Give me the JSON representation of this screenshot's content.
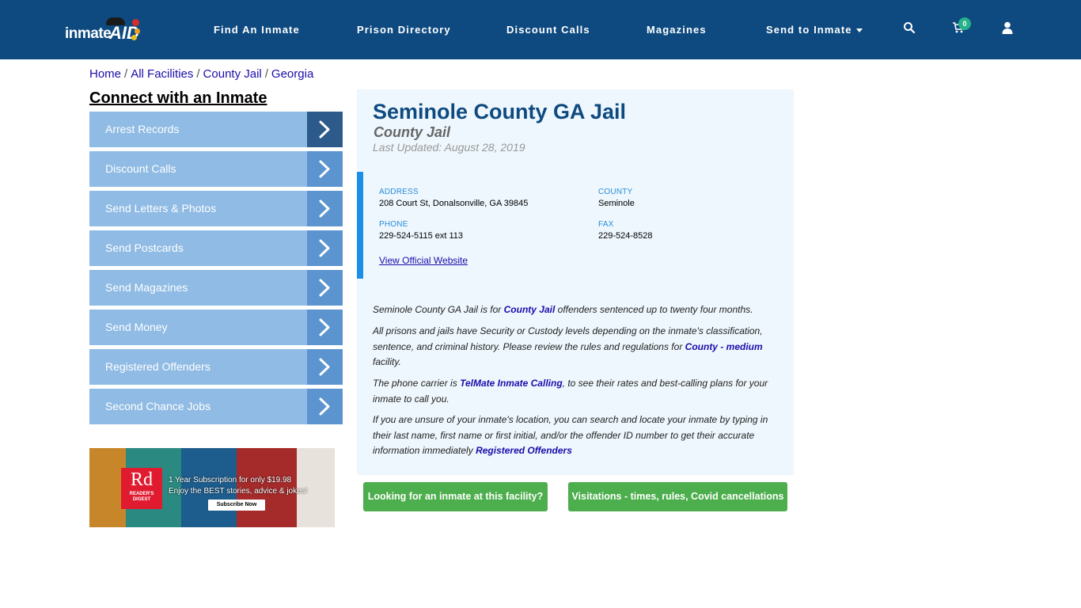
{
  "header": {
    "logo": {
      "part1": "inmate",
      "part2": "AID"
    },
    "nav": [
      {
        "label": "Find An Inmate"
      },
      {
        "label": "Prison Directory"
      },
      {
        "label": "Discount Calls"
      },
      {
        "label": "Magazines"
      },
      {
        "label": "Send to Inmate",
        "dropdown": true
      }
    ],
    "icons": {
      "search": "search-icon",
      "cart": "cart-icon",
      "user": "user-icon"
    },
    "cart_count": "0"
  },
  "breadcrumb": [
    {
      "label": "Home"
    },
    {
      "label": "All Facilities"
    },
    {
      "label": "County Jail"
    },
    {
      "label": "Georgia"
    }
  ],
  "sidebar": {
    "title": "Connect with an Inmate",
    "items": [
      {
        "label": "Arrest Records"
      },
      {
        "label": "Discount Calls"
      },
      {
        "label": "Send Letters & Photos"
      },
      {
        "label": "Send Postcards"
      },
      {
        "label": "Send Magazines"
      },
      {
        "label": "Send Money"
      },
      {
        "label": "Registered Offenders"
      },
      {
        "label": "Second Chance Jobs"
      }
    ],
    "ad": {
      "brand_short": "Rd",
      "brand_long": "READER'S DIGEST",
      "line1": "1 Year Subscription for only $19.98",
      "line2": "Enjoy the BEST stories, advice & jokes!",
      "button": "Subscribe Now"
    }
  },
  "facility": {
    "title": "Seminole County GA Jail",
    "type": "County Jail",
    "last_updated": "Last Updated: August 28, 2019",
    "address_label": "ADDRESS",
    "address": "208 Court St, Donalsonville, GA 39845",
    "county_label": "COUNTY",
    "county": "Seminole",
    "phone_label": "PHONE",
    "phone": "229-524-5115 ext 113",
    "fax_label": "FAX",
    "fax": "229-524-8528",
    "website_link": "View Official Website"
  },
  "description": {
    "p1": {
      "a": "Seminole County GA Jail is for ",
      "link": "County Jail",
      "b": " offenders sentenced up to twenty four months."
    },
    "p2": {
      "a": "All prisons and jails have Security or Custody levels depending on the inmate's classification, sentence, and criminal history. Please review the rules and regulations for ",
      "link": "County - medium",
      "b": " facility."
    },
    "p3": {
      "a": "The phone carrier is ",
      "link": "TelMate Inmate Calling",
      "b": ", to see their rates and best-calling plans for your inmate to call you."
    },
    "p4": {
      "a": "If you are unsure of your inmate's location, you can search and locate your inmate by typing in their last name, first name or first initial, and/or the offender ID number to get their accurate information immediately ",
      "link": "Registered Offenders",
      "b": ""
    }
  },
  "buttons": {
    "find_inmate": "Looking for an inmate at this facility?",
    "visitation": "Visitations - times, rules, Covid cancellations"
  },
  "colors": {
    "nav_bg": "#0e4a80",
    "sidebar_item": "#8fbbe4",
    "sidebar_arrow": "#5b94cf",
    "sidebar_arrow_active": "#2c5a8a",
    "card_bg": "#eef7fd",
    "accent_bar": "#1a8fe8",
    "button_green": "#4cae4c",
    "badge": "#26b18a"
  }
}
